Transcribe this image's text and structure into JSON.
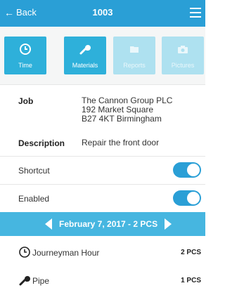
{
  "header": {
    "back_label": "Back",
    "title": "1003"
  },
  "tiles": [
    {
      "label": "Time",
      "icon": "clock-icon",
      "active": true
    },
    {
      "label": "Materials",
      "icon": "wrench-icon",
      "active": true
    },
    {
      "label": "Reports",
      "icon": "folder-icon",
      "active": false
    },
    {
      "label": "Pictures",
      "icon": "camera-icon",
      "active": false
    }
  ],
  "job": {
    "label": "Job",
    "line1": "The Cannon Group PLC",
    "line2": "192 Market Square",
    "line3": "B27 4KT Birmingham"
  },
  "description": {
    "label": "Description",
    "value": "Repair the front door"
  },
  "toggles": [
    {
      "label": "Shortcut",
      "on": true
    },
    {
      "label": "Enabled",
      "on": true
    }
  ],
  "date_bar": {
    "text": "February 7, 2017 - 2 PCS"
  },
  "items": [
    {
      "label": "Journeyman Hour",
      "qty": "2 PCS",
      "icon": "clock-icon"
    },
    {
      "label": "Pipe",
      "qty": "1 PCS",
      "icon": "wrench-icon"
    }
  ],
  "colors": {
    "accent": "#2a9fd6",
    "tile_active": "#2eb0da",
    "tile_inactive": "#aee1f0",
    "date_bar": "#46b6e0"
  }
}
